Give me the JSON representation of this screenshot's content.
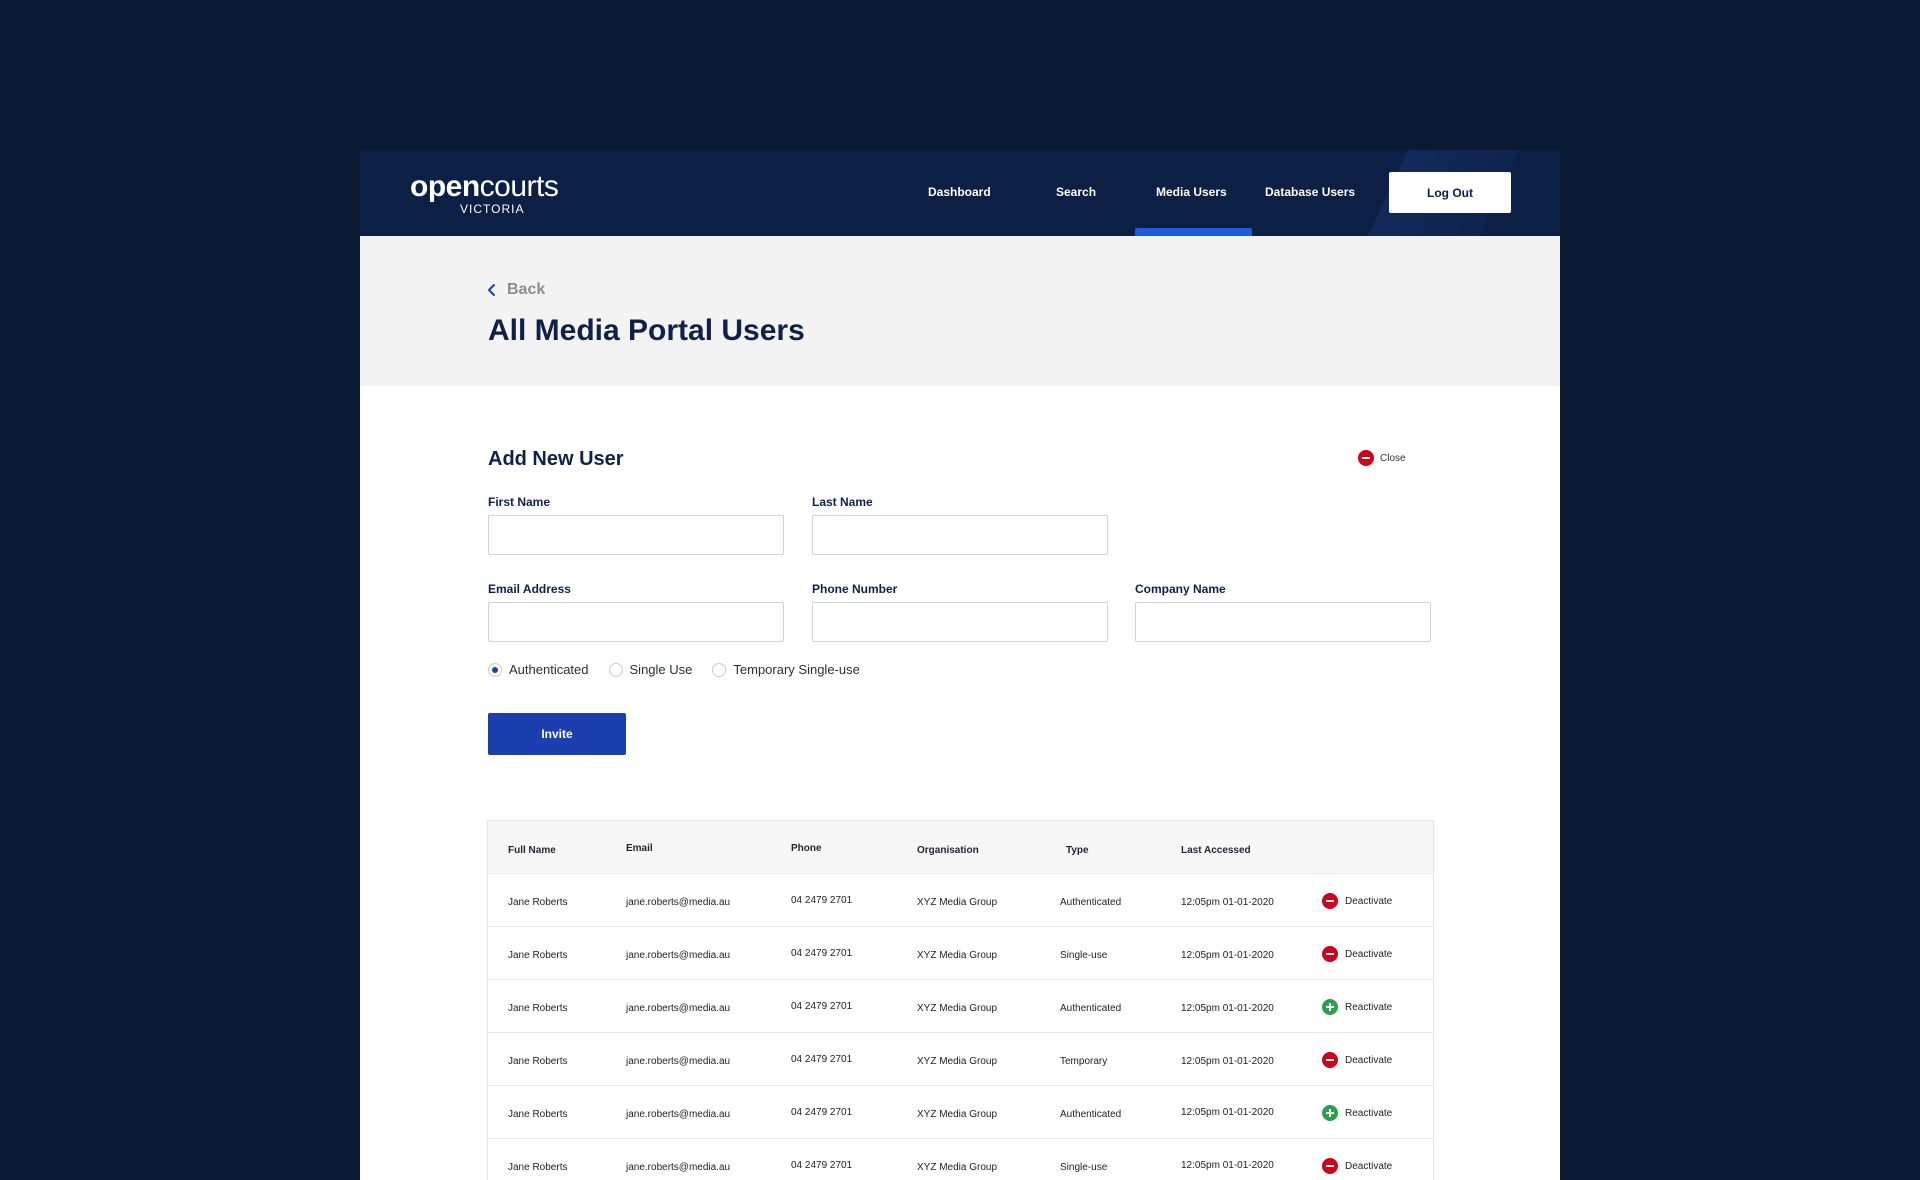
{
  "header": {
    "logo_word_bold": "open",
    "logo_word_light": "courts",
    "logo_subtitle": "VICTORIA",
    "nav": [
      {
        "label": "Dashboard"
      },
      {
        "label": "Search"
      },
      {
        "label": "Media Users",
        "active": true
      },
      {
        "label": "Database Users"
      }
    ],
    "logout_label": "Log Out"
  },
  "title_band": {
    "back_label": "Back",
    "page_title": "All Media Portal Users"
  },
  "form": {
    "title": "Add New User",
    "close_label": "Close",
    "fields": {
      "first_name": {
        "label": "First Name",
        "value": ""
      },
      "last_name": {
        "label": "Last Name",
        "value": ""
      },
      "email": {
        "label": "Email Address",
        "value": ""
      },
      "phone": {
        "label": "Phone Number",
        "value": ""
      },
      "company": {
        "label": "Company Name",
        "value": ""
      }
    },
    "user_types": [
      {
        "label": "Authenticated",
        "selected": true
      },
      {
        "label": "Single Use",
        "selected": false
      },
      {
        "label": "Temporary Single-use",
        "selected": false
      }
    ],
    "invite_label": "Invite"
  },
  "table": {
    "columns": [
      "Full Name",
      "Email",
      "Phone",
      "Organisation",
      "Type",
      "Last Accessed"
    ],
    "rows": [
      {
        "name": "Jane Roberts",
        "email": "jane.roberts@media.au",
        "phone": "04 2479 2701",
        "org": "XYZ Media Group",
        "type": "Authenticated",
        "last": "12:05pm 01-01-2020",
        "action": "Deactivate"
      },
      {
        "name": "Jane Roberts",
        "email": "jane.roberts@media.au",
        "phone": "04 2479 2701",
        "org": "XYZ Media Group",
        "type": "Single-use",
        "last": "12:05pm 01-01-2020",
        "action": "Deactivate"
      },
      {
        "name": "Jane Roberts",
        "email": "jane.roberts@media.au",
        "phone": "04 2479 2701",
        "org": "XYZ Media Group",
        "type": "Authenticated",
        "last": "12:05pm 01-01-2020",
        "action": "Reactivate"
      },
      {
        "name": "Jane Roberts",
        "email": "jane.roberts@media.au",
        "phone": "04 2479 2701",
        "org": "XYZ Media Group",
        "type": "Temporary",
        "last": "12:05pm 01-01-2020",
        "action": "Deactivate"
      },
      {
        "name": "Jane Roberts",
        "email": "jane.roberts@media.au",
        "phone": "04 2479 2701",
        "org": "XYZ Media Group",
        "type": "Authenticated",
        "last": "12:05pm 01-01-2020",
        "action": "Reactivate"
      },
      {
        "name": "Jane Roberts",
        "email": "jane.roberts@media.au",
        "phone": "04 2479 2701",
        "org": "XYZ Media Group",
        "type": "Single-use",
        "last": "12:05pm 01-01-2020",
        "action": "Deactivate"
      }
    ]
  },
  "colors": {
    "page_bg": "#0b1a33",
    "header_bg": "#0c1f44",
    "accent_blue": "#1b3fae",
    "active_tab": "#1e5bdc",
    "deactivate_red": "#d0021b",
    "reactivate_green": "#2e9e4f"
  }
}
